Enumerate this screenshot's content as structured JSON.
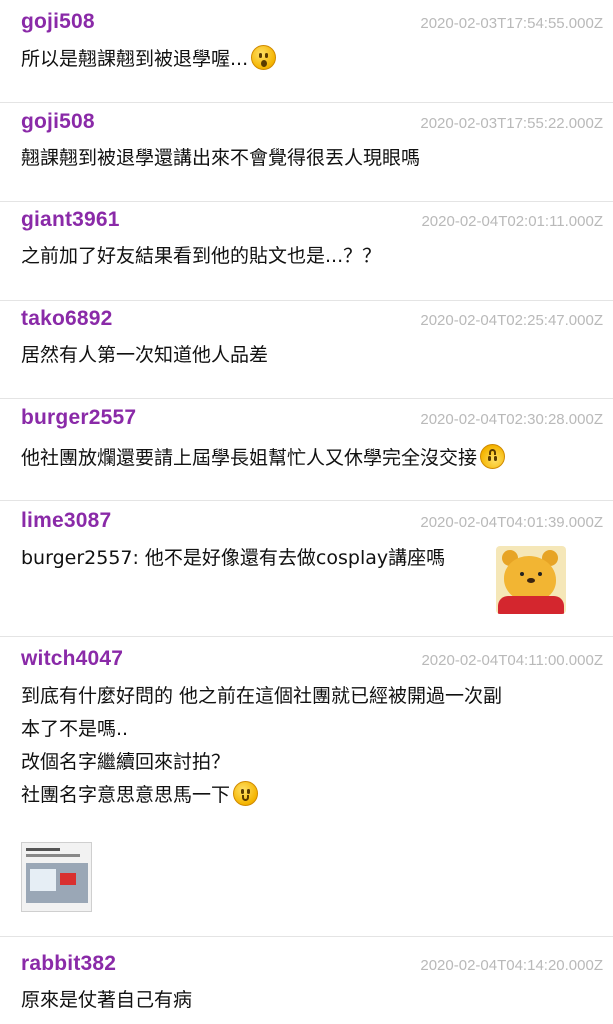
{
  "comments": [
    {
      "user": "goji508",
      "time": "2020-02-03T17:54:55.000Z",
      "lines": [
        "所以是翹課翹到被退學喔..."
      ],
      "emoji": "astonished-face"
    },
    {
      "user": "goji508",
      "time": "2020-02-03T17:55:22.000Z",
      "lines": [
        "翹課翹到被退學還講出來不會覺得很丟人現眼嗎"
      ]
    },
    {
      "user": "giant3961",
      "time": "2020-02-04T02:01:11.000Z",
      "lines": [
        "之前加了好友結果看到他的貼文也是...？？"
      ]
    },
    {
      "user": "tako6892",
      "time": "2020-02-04T02:25:47.000Z",
      "lines": [
        "居然有人第一次知道他人品差"
      ]
    },
    {
      "user": "burger2557",
      "time": "2020-02-04T02:30:28.000Z",
      "lines": [
        "他社團放爛還要請上屆學長姐幫忙人又休學完全沒交接"
      ],
      "emoji": "upside-down-face"
    },
    {
      "user": "lime3087",
      "time": "2020-02-04T04:01:39.000Z",
      "lines": [
        "burger2557: 他不是好像還有去做cosplay講座嗎"
      ],
      "sticker": "pooh-sticker"
    },
    {
      "user": "witch4047",
      "time": "2020-02-04T04:11:00.000Z",
      "lines": [
        "到底有什麼好問的 他之前在這個社團就已經被開過一次副",
        "本了不是嗎..",
        "改個名字繼續回來討拍？",
        "社團名字意思意思馬一下"
      ],
      "emoji": "smiling-face",
      "attachment": "screenshot-thumbnail"
    },
    {
      "user": "rabbit382",
      "time": "2020-02-04T04:14:20.000Z",
      "lines": [
        "原來是仗著自己有病"
      ]
    }
  ]
}
